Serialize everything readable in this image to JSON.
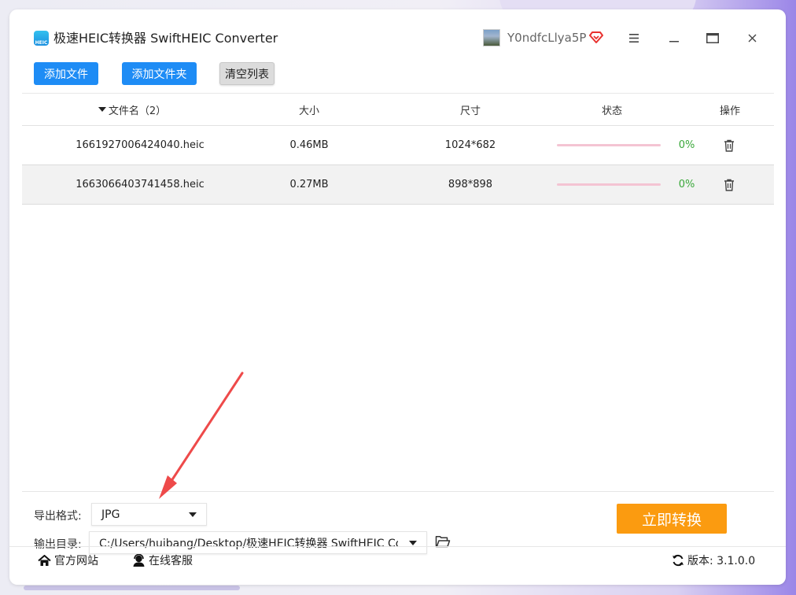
{
  "app": {
    "title": "极速HEIC转换器 SwiftHEIC Converter",
    "logo_text": "HEIC",
    "username": "Y0ndfcLlya5P"
  },
  "toolbar": {
    "add_file": "添加文件",
    "add_folder": "添加文件夹",
    "clear_list": "清空列表"
  },
  "table": {
    "headers": {
      "name": "文件名（2）",
      "size": "大小",
      "dimensions": "尺寸",
      "status": "状态",
      "actions": "操作"
    },
    "rows": [
      {
        "name": "1661927006424040.heic",
        "size": "0.46MB",
        "dimensions": "1024*682",
        "progress": "0%"
      },
      {
        "name": "1663066403741458.heic",
        "size": "0.27MB",
        "dimensions": "898*898",
        "progress": "0%"
      }
    ]
  },
  "settings": {
    "format_label": "导出格式:",
    "format_value": "JPG",
    "output_label": "输出目录:",
    "output_value": "C:/Users/huibang/Desktop/极速HEIC转换器 SwiftHEIC Co"
  },
  "convert_label": "立即转换",
  "footer": {
    "website": "官方网站",
    "support": "在线客服",
    "version": "版本:  3.1.0.0"
  },
  "colors": {
    "accent_blue": "#1e8cf5",
    "convert_orange": "#fb9b10",
    "progress_pink": "#f4c4d3",
    "percent_green": "#3aa83a"
  }
}
